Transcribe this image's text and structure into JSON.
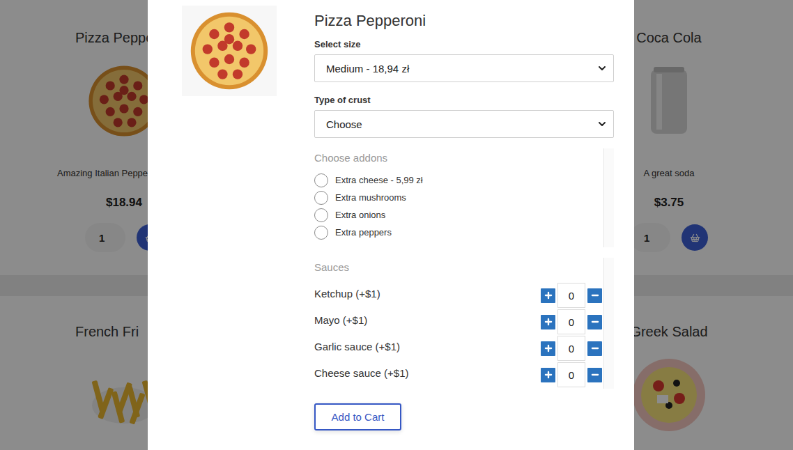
{
  "background": {
    "cards": [
      {
        "title": "Pizza Peppe",
        "description": "Amazing Italian Peppe",
        "price": "$18.94",
        "quantity": "1"
      },
      {
        "title": "Coca Cola",
        "description": "A great soda",
        "price": "$3.75",
        "quantity": "1"
      },
      {
        "title": "French Fri"
      },
      {
        "title": "Greek Salad"
      }
    ]
  },
  "modal": {
    "title": "Pizza Pepperoni",
    "size": {
      "label": "Select size",
      "value": "Medium - 18,94 zł"
    },
    "crust": {
      "label": "Type of crust",
      "value": "Choose"
    },
    "addons": {
      "title": "Choose addons",
      "items": [
        {
          "label": "Extra cheese - 5,99 zł",
          "selected": false
        },
        {
          "label": "Extra mushrooms",
          "selected": false
        },
        {
          "label": "Extra onions",
          "selected": false
        },
        {
          "label": "Extra peppers",
          "selected": false
        }
      ]
    },
    "sauces": {
      "title": "Sauces",
      "items": [
        {
          "label": "Ketchup (+$1)",
          "count": "0"
        },
        {
          "label": "Mayo (+$1)",
          "count": "0"
        },
        {
          "label": "Garlic sauce (+$1)",
          "count": "0"
        },
        {
          "label": "Cheese sauce (+$1)",
          "count": "0"
        }
      ]
    },
    "button": "Add to Cart"
  }
}
